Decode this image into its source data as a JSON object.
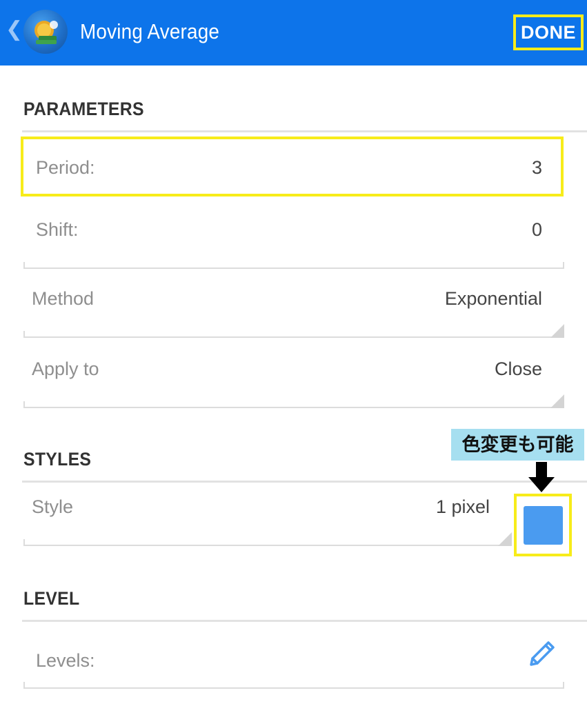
{
  "header": {
    "title": "Moving Average",
    "done_label": "DONE"
  },
  "sections": {
    "parameters": "PARAMETERS",
    "styles": "STYLES",
    "level": "LEVEL"
  },
  "parameters": {
    "period": {
      "label": "Period:",
      "value": "3"
    },
    "shift": {
      "label": "Shift:",
      "value": "0"
    },
    "method": {
      "label": "Method",
      "value": "Exponential"
    },
    "apply_to": {
      "label": "Apply to",
      "value": "Close"
    }
  },
  "styles": {
    "style": {
      "label": "Style",
      "value": "1 pixel"
    },
    "line_color": "#4a9bf0"
  },
  "level": {
    "levels": {
      "label": "Levels:"
    }
  },
  "annotation": {
    "note": "色変更も可能"
  },
  "colors": {
    "topbar": "#0d74ea",
    "highlight": "#f7ec1a",
    "annotation_bg": "#a6dff0"
  },
  "icons": {
    "back": "chevron-left-icon",
    "app": "metatrader-app-icon",
    "edit": "pencil-icon",
    "pointer": "arrow-down-icon"
  }
}
